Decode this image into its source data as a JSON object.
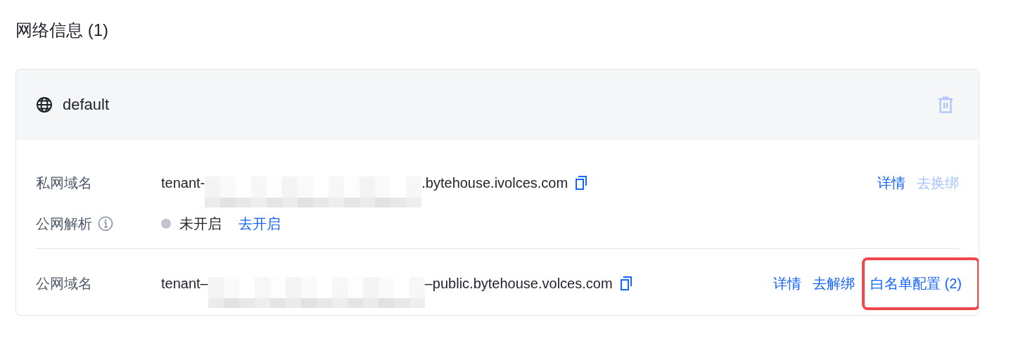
{
  "section": {
    "title": "网络信息 (1)"
  },
  "network": {
    "name": "default",
    "delete_disabled": true,
    "groups": [
      {
        "rows": [
          {
            "kind": "domain",
            "label": "私网域名",
            "prefix": "tenant-",
            "suffix": ".bytehouse.ivolces.com",
            "actions": [
              {
                "label": "详情",
                "disabled": false,
                "highlighted": false
              },
              {
                "label": "去换绑",
                "disabled": true,
                "highlighted": false
              }
            ]
          },
          {
            "kind": "status",
            "label": "公网解析",
            "status": "未开启",
            "enabled": false,
            "action": "去开启"
          }
        ]
      },
      {
        "rows": [
          {
            "kind": "domain",
            "label": "公网域名",
            "prefix": "tenant–",
            "suffix": "–public.bytehouse.volces.com",
            "actions": [
              {
                "label": "详情",
                "disabled": false,
                "highlighted": false
              },
              {
                "label": "去解绑",
                "disabled": false,
                "highlighted": false
              },
              {
                "label": "白名单配置 (2)",
                "disabled": false,
                "highlighted": true
              }
            ]
          }
        ]
      }
    ]
  }
}
